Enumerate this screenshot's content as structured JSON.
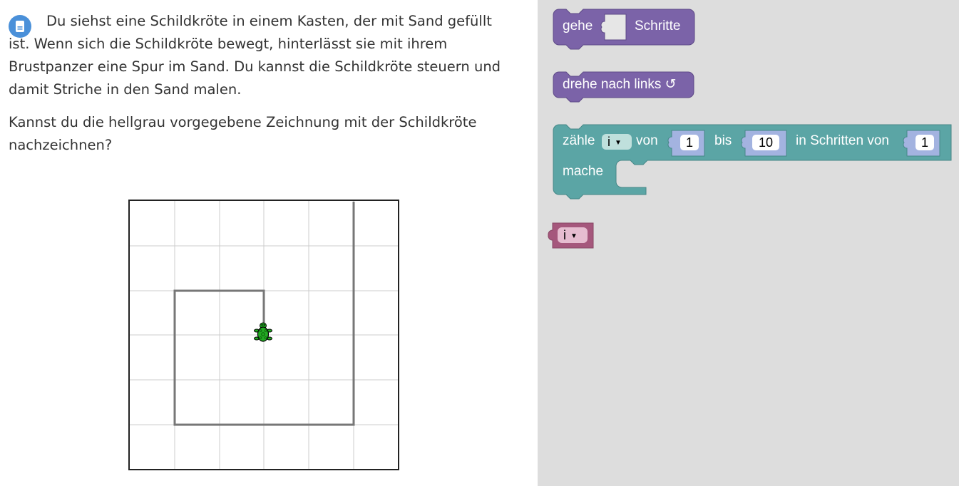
{
  "task": {
    "paragraph1": "Du siehst eine Schildkröte in einem Kasten, der mit Sand gefüllt ist. Wenn sich die Schildkröte bewegt, hinterlässt sie mit ihrem Brustpanzer eine Spur im Sand. Du kannst die Schildkröte steuern und damit Striche in den Sand malen.",
    "paragraph2": "Kannst du die hellgrau vorgegebene Zeichnung mit der Schildkröte nachzeichnen?"
  },
  "icons": {
    "info": "document-icon",
    "turtle": "turtle-icon"
  },
  "colors": {
    "info_icon": "#4a90d9",
    "motion_block": "#7b63a8",
    "loop_block": "#5ba5a5",
    "variable_block": "#a5577c",
    "toolbox_bg": "#dddddd",
    "target_drawing": "#777777",
    "grid_line": "#cccccc",
    "turtle": "#22aa22"
  },
  "toolbox": {
    "move_block": {
      "label": "gehe",
      "unit": "Schritte",
      "value": ""
    },
    "turn_block": {
      "label": "drehe nach links ↺"
    },
    "loop_block": {
      "label": "zähle",
      "variable": "i",
      "from_label": "von",
      "from_value": "1",
      "to_label": "bis",
      "to_value": "10",
      "step_label": "in Schritten von",
      "step_value": "1",
      "do_label": "mache"
    },
    "variable_block": {
      "variable": "i"
    }
  }
}
